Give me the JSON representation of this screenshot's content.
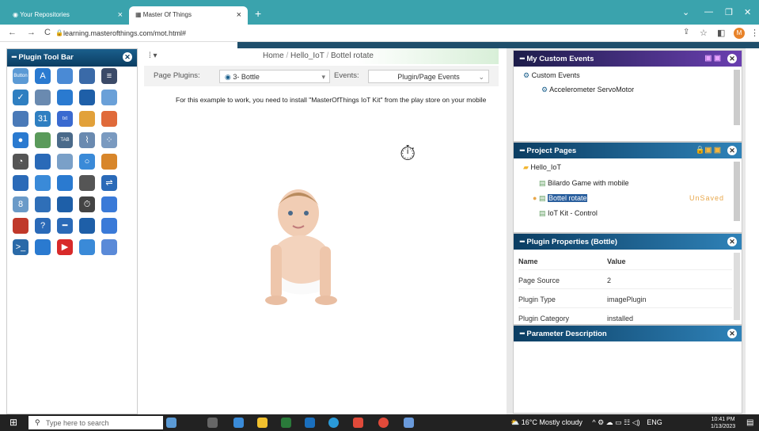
{
  "browser": {
    "tabs": [
      {
        "label": "Your Repositories",
        "close": "×"
      },
      {
        "label": "Master Of Things",
        "close": "×"
      }
    ],
    "url": "learning.masterofthings.com/mot.html#",
    "profile_initial": "M"
  },
  "left_panel": {
    "title": "Plugin Tool Bar",
    "icons": [
      "button-icon",
      "text-icon",
      "input-icon",
      "frame-icon",
      "list-icon",
      "checkbox-icon",
      "panel-icon",
      "dropdown-icon",
      "menu-icon",
      "table-icon",
      "grid-icon",
      "calendar-icon",
      "chat-icon",
      "color-picker-icon",
      "wheel-icon",
      "pin-icon",
      "search-image-icon",
      "form-icon",
      "line-chart-icon",
      "scatter-icon",
      "pie-chart-icon",
      "bar-gauge-icon",
      "cube-icon",
      "circle-icon",
      "globe-icon",
      "gauge-icon",
      "line-icon",
      "image-icon",
      "timer-icon",
      "slider-icon",
      "digit-icon",
      "dial-icon",
      "meter-icon",
      "stopwatch-icon",
      "wave-icon",
      "car-icon",
      "help-icon",
      "switch-icon",
      "bottle-icon",
      "robot-icon",
      "terminal-icon",
      "cloud-upload-icon",
      "play-icon",
      "dashboard-icon",
      "calendar-grid-icon"
    ],
    "button_label": "Button",
    "text_glyph": "A",
    "calendar_day": "31",
    "chat_label": "txt",
    "tab_label": "TAB",
    "digit_glyph": "8",
    "terminal_glyph": ">_"
  },
  "center": {
    "breadcrumb": [
      "Home",
      "Hello_IoT",
      "Bottel rotate"
    ],
    "breadcrumb_sep": "/",
    "left_menu": "⁞ ▾",
    "page_plugins_label": "Page Plugins:",
    "page_plugins_value": "3- Bottle",
    "events_label": "Events:",
    "events_value": "Plugin/Page Events",
    "note": "For this example to work, you need to install \"MasterOfThings IoT Kit\" from the play store on your mobile"
  },
  "right": {
    "custom_events": {
      "title": "My Custom Events",
      "root": "Custom Events",
      "child": "Accelerometer ServoMotor"
    },
    "project_pages": {
      "title": "Project Pages",
      "folder": "Hello_IoT",
      "pages": [
        "Bilardo Game with mobile",
        "Bottel rotate",
        "IoT Kit - Control"
      ],
      "unsaved": "UnSaved"
    },
    "plugin_properties": {
      "title": "Plugin Properties (Bottle)",
      "headers": [
        "Name",
        "Value"
      ],
      "rows": [
        [
          "Page Source",
          "2"
        ],
        [
          "Plugin Type",
          "imagePlugin"
        ],
        [
          "Plugin Category",
          "installed"
        ]
      ]
    },
    "parameter_description": {
      "title": "Parameter Description"
    }
  },
  "taskbar": {
    "search_placeholder": "Type here to search",
    "weather": "16°C  Mostly cloudy",
    "lang": "ENG",
    "time": "10:41 PM",
    "date": "1/13/2023"
  },
  "colors": {
    "accent_teal": "#3aa3ad",
    "panel_header_blue": "#0b3d62",
    "custom_events_purple": "#4a2a8c",
    "unsaved_orange": "#e8a74a"
  }
}
